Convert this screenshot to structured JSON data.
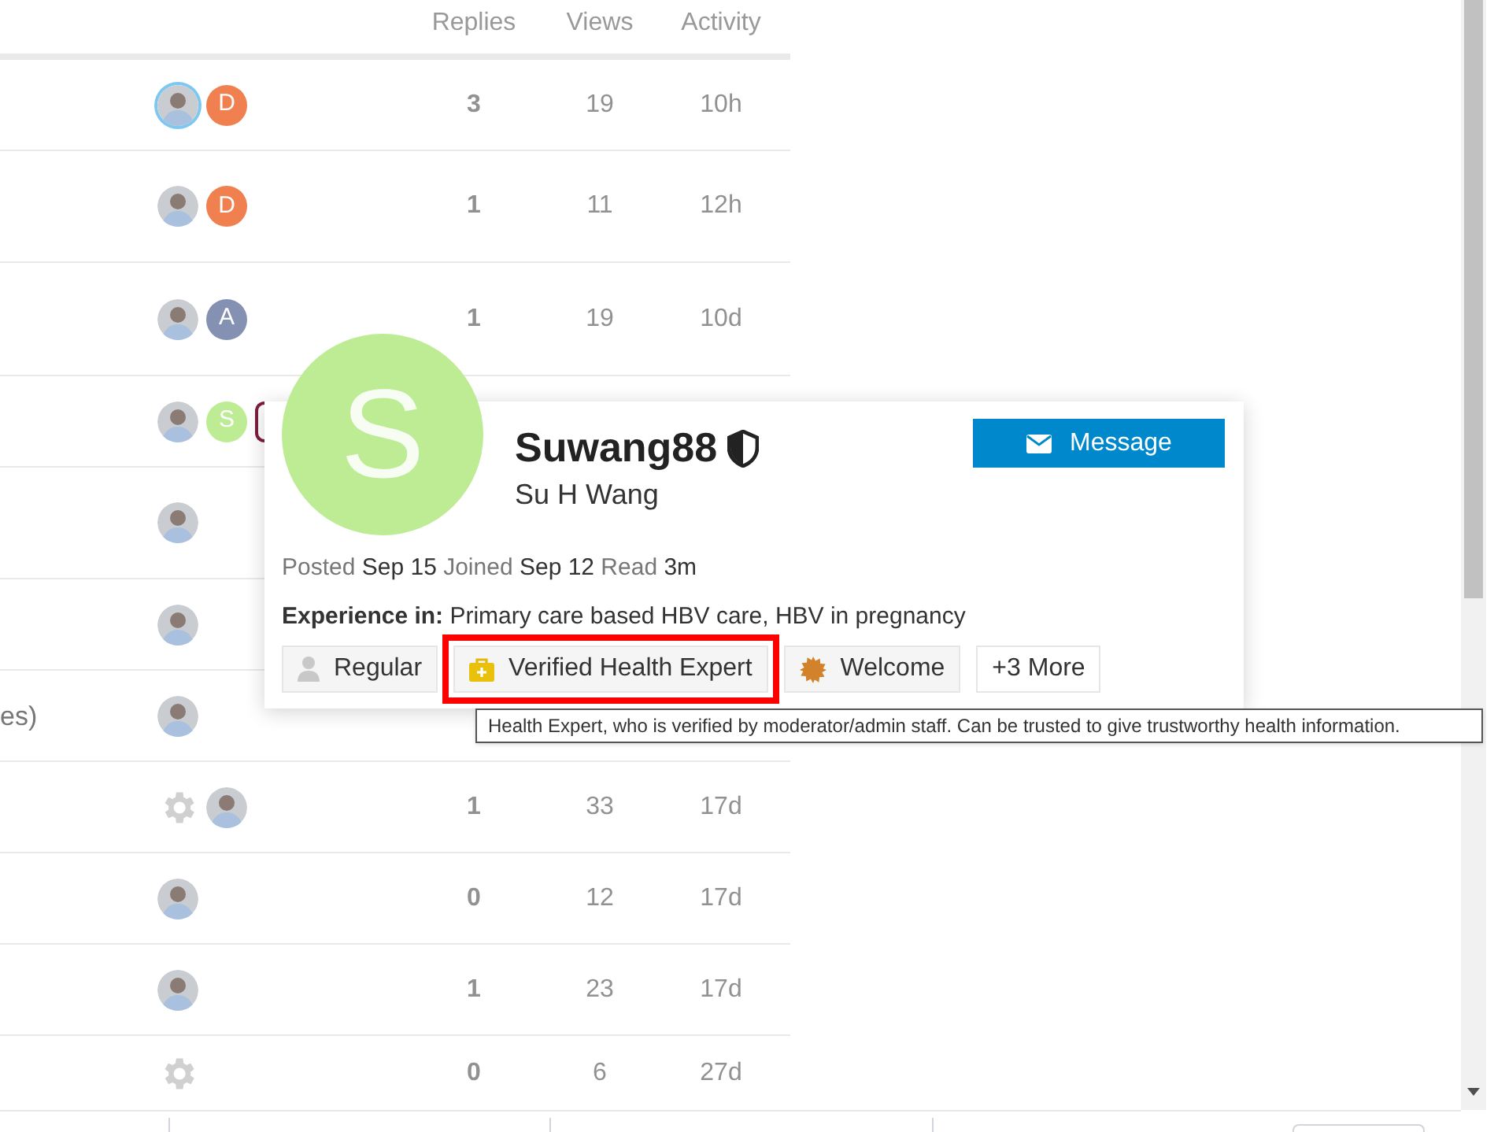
{
  "table": {
    "columns": [
      "Replies",
      "Views",
      "Activity"
    ],
    "rows": [
      {
        "posters": [
          {
            "kind": "photo",
            "highlighted": true
          },
          {
            "kind": "letter",
            "letter": "D",
            "color": "#f0804f"
          }
        ],
        "replies": "3",
        "views": "19",
        "activity": "10h"
      },
      {
        "posters": [
          {
            "kind": "photo",
            "highlighted": false
          },
          {
            "kind": "letter",
            "letter": "D",
            "color": "#f0804f"
          }
        ],
        "replies": "1",
        "views": "11",
        "activity": "12h"
      },
      {
        "posters": [
          {
            "kind": "photo",
            "highlighted": false
          },
          {
            "kind": "letter",
            "letter": "A",
            "color": "#8491b3"
          }
        ],
        "replies": "1",
        "views": "19",
        "activity": "10d"
      },
      {
        "posters": [
          {
            "kind": "photo",
            "highlighted": false
          },
          {
            "kind": "letter",
            "letter": "S",
            "color": "#bdec94"
          },
          {
            "kind": "partial"
          }
        ]
      },
      {
        "posters": [
          {
            "kind": "photo",
            "highlighted": false
          }
        ]
      },
      {
        "posters": [
          {
            "kind": "photo",
            "highlighted": false
          }
        ]
      },
      {
        "title_fragment": "es)",
        "posters": [
          {
            "kind": "photo",
            "highlighted": false
          }
        ]
      },
      {
        "posters": [
          {
            "kind": "gear"
          },
          {
            "kind": "photo",
            "highlighted": false
          }
        ],
        "replies": "1",
        "views": "33",
        "activity": "17d"
      },
      {
        "posters": [
          {
            "kind": "photo",
            "highlighted": false
          }
        ],
        "replies": "0",
        "views": "12",
        "activity": "17d"
      },
      {
        "posters": [
          {
            "kind": "photo",
            "highlighted": false
          }
        ],
        "replies": "1",
        "views": "23",
        "activity": "17d"
      },
      {
        "posters": [
          {
            "kind": "gear"
          }
        ],
        "replies": "0",
        "views": "6",
        "activity": "27d"
      }
    ]
  },
  "user_card": {
    "avatar": {
      "letter": "S",
      "color": "#bdec94"
    },
    "username": "Suwang88",
    "full_name": "Su H Wang",
    "message_button": "Message",
    "stats": "Posted **Sep 15** Joined **Sep 12** Read **3m**",
    "experience": "**Experience in:** Primary care based HBV care, HBV in pregnancy",
    "badges": [
      {
        "kind": "user",
        "label": "Regular",
        "highlighted": false
      },
      {
        "kind": "kit",
        "label": "Verified Health Expert",
        "highlighted": true
      },
      {
        "kind": "sun",
        "label": "Welcome",
        "highlighted": false
      },
      {
        "kind": "more",
        "label": "+3 More",
        "highlighted": false
      }
    ]
  },
  "tooltip": "Health Expert, who is verified by moderator/admin staff. Can be trusted to give trustworthy health information."
}
